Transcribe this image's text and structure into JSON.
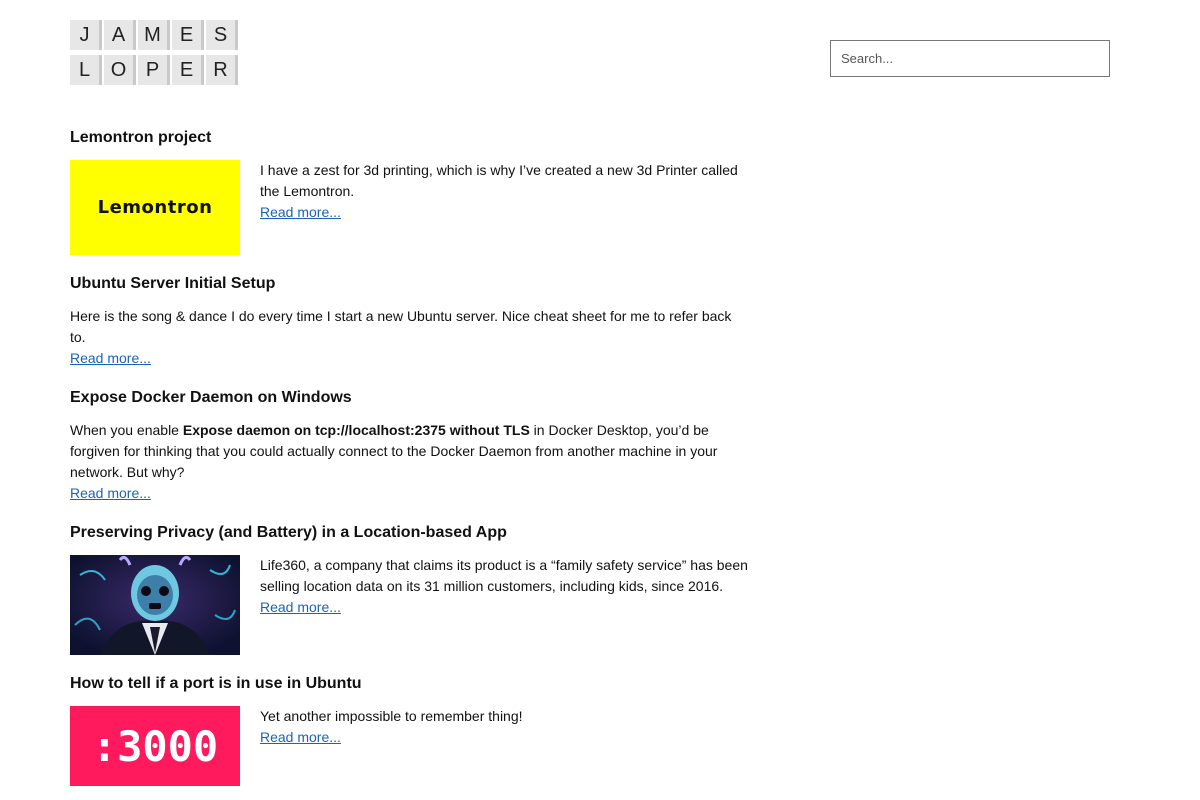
{
  "logo": {
    "row1": [
      "J",
      "A",
      "M",
      "E",
      "S"
    ],
    "row2": [
      "L",
      "O",
      "P",
      "E",
      "R"
    ]
  },
  "search": {
    "placeholder": "Search..."
  },
  "posts": [
    {
      "title": "Lemontron project",
      "thumb_text": "Lemontron",
      "text": "I have a zest for 3d printing, which is why I’ve created a new 3d Printer called the Lemontron.",
      "read_more": "Read more..."
    },
    {
      "title": "Ubuntu Server Initial Setup",
      "text": "Here is the song & dance I do every time I start a new Ubuntu server. Nice cheat sheet for me to refer back to.",
      "read_more": "Read more..."
    },
    {
      "title": "Expose Docker Daemon on Windows",
      "text_before": "When you enable ",
      "text_bold": "Expose daemon on tcp://localhost:2375 without TLS",
      "text_after": " in Docker Desktop, you’d be forgiven for thinking that you could actually connect to the Docker Daemon from another machine in your network. But why?",
      "read_more": "Read more..."
    },
    {
      "title": "Preserving Privacy (and Battery) in a Location-based App",
      "text": "Life360, a company that claims its product is a “family safety service” has been selling location data on its 31 million customers, including kids, since 2016.",
      "read_more": "Read more..."
    },
    {
      "title": "How to tell if a port is in use in Ubuntu",
      "thumb_text": ":3000",
      "text": "Yet another impossible to remember thing!",
      "read_more": "Read more..."
    }
  ]
}
